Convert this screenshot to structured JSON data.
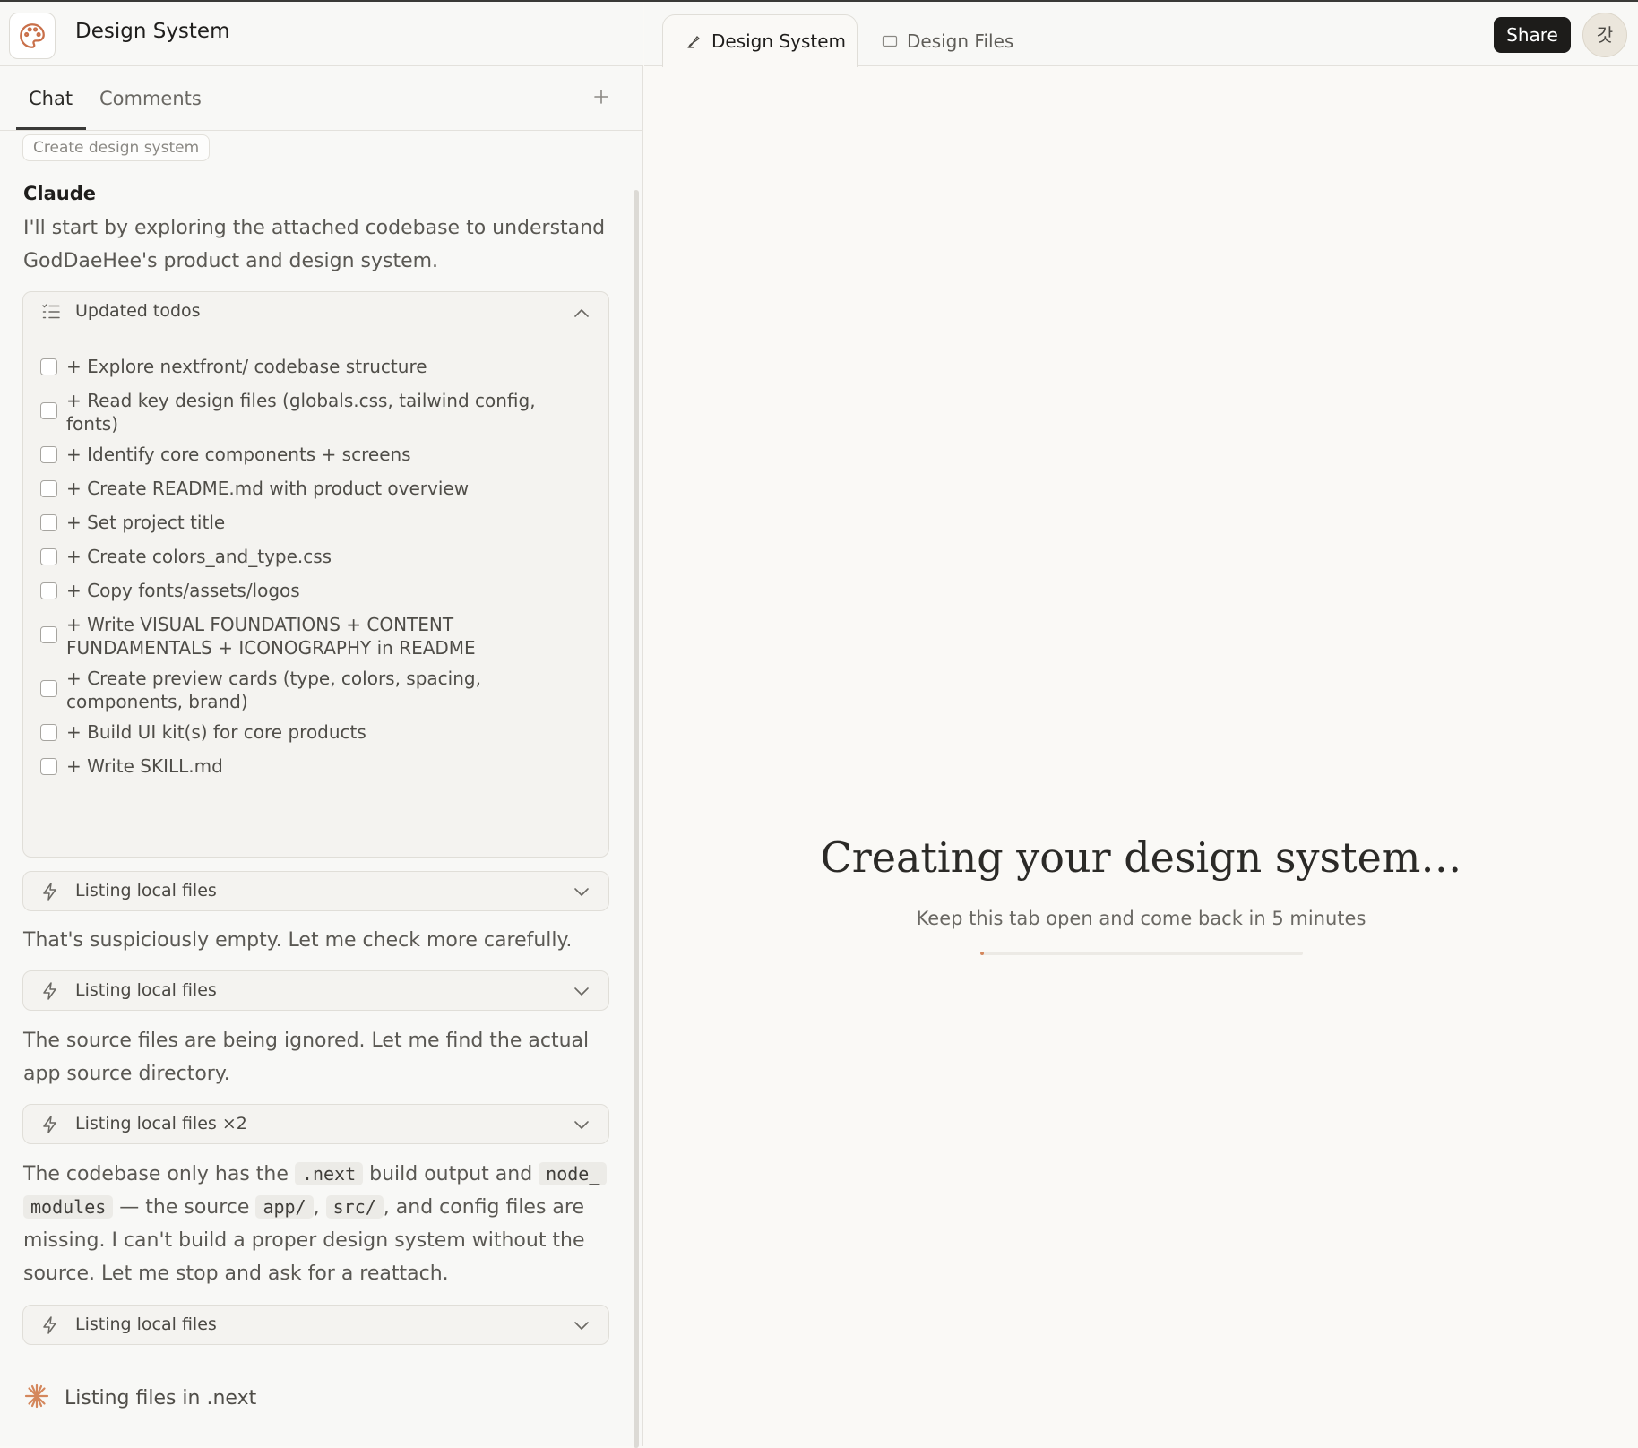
{
  "app": {
    "project_title": "Design System"
  },
  "left_tabs": {
    "chat": "Chat",
    "comments": "Comments"
  },
  "chat": {
    "user_chip": "Create design system",
    "author": "Claude",
    "intro": "I'll start by exploring the attached codebase to understand GodDaeHee's product and design system.",
    "todo_header": "Updated todos",
    "todos": [
      "+ Explore nextfront/ codebase structure",
      "+ Read key design files (globals.css, tailwind config, fonts)",
      "+ Identify core components + screens",
      "+ Create README.md with product overview",
      "+ Set project title",
      "+ Create colors_and_type.css",
      "+ Copy fonts/assets/logos",
      "+ Write VISUAL FOUNDATIONS + CONTENT FUNDAMENTALS + ICONOGRAPHY in README",
      "+ Create preview cards (type, colors, spacing, components, brand)",
      "+ Build UI kit(s) for core products",
      "+ Write SKILL.md"
    ],
    "tool_calls": [
      "Listing local files",
      "Listing local files",
      "Listing local files ×2",
      "Listing local files"
    ],
    "msg_empty": "That's suspiciously empty. Let me check more carefully.",
    "msg_ignored": "The source files are being ignored. Let me find the actual app source directory.",
    "msg_codebase": {
      "t1": "The codebase only has the ",
      "c1": ".next",
      "t2": " build output and ",
      "c2a": "node_",
      "c2b": "modules",
      "t3": " — the source ",
      "c3": "app/",
      "t4": ", ",
      "c4": "src/",
      "t5": ", and config files are missing. I can't build a proper design system without the source. Let me stop and ask for a reattach."
    },
    "status": "Listing files in .next"
  },
  "file_tabs": {
    "active": "Design System",
    "inactive": "Design Files"
  },
  "header_actions": {
    "share": "Share",
    "avatar_initial": "갓"
  },
  "canvas": {
    "heading": "Creating your design system…",
    "subheading": "Keep this tab open and come back in 5 minutes",
    "progress": 0.01
  },
  "colors": {
    "accent": "#d4875c",
    "share_bg": "#1d1c1a"
  }
}
